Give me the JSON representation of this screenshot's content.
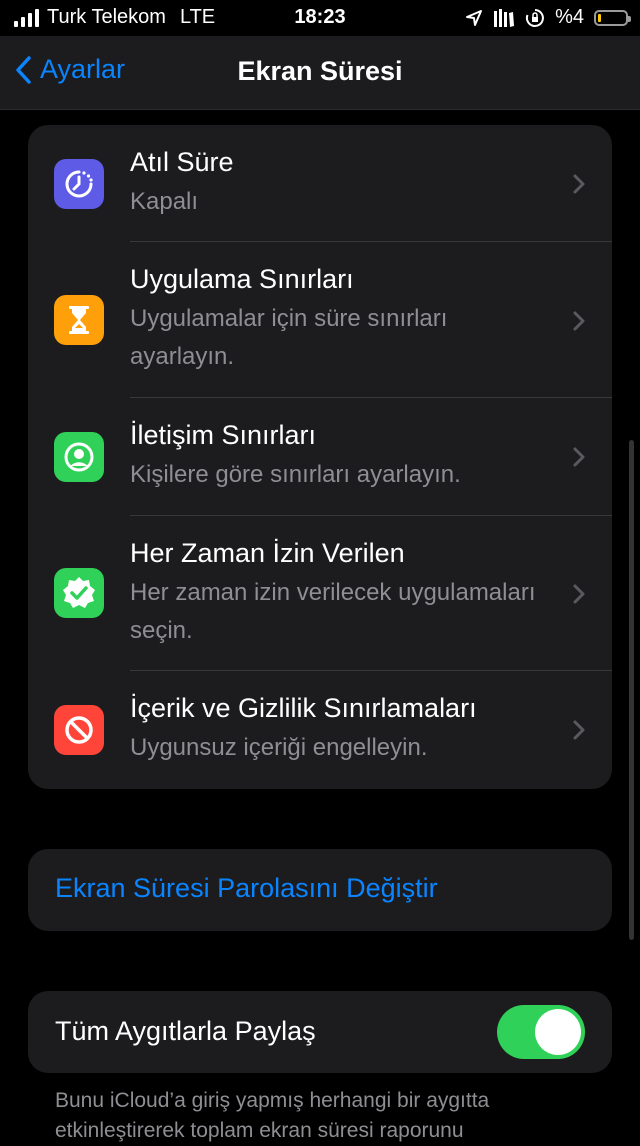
{
  "status_bar": {
    "carrier": "Turk Telekom",
    "network": "LTE",
    "time": "18:23",
    "battery_percent": "%4",
    "battery_level": 0.04,
    "icons": [
      "signal-icon",
      "location-icon",
      "library-icon",
      "rotation-lock-icon",
      "battery-icon"
    ]
  },
  "nav": {
    "back_label": "Ayarlar",
    "title": "Ekran Süresi"
  },
  "settings": {
    "items": [
      {
        "title": "Atıl Süre",
        "subtitle": "Kapalı",
        "icon": "downtime-icon",
        "color": "#5e5ce6"
      },
      {
        "title": "Uygulama Sınırları",
        "subtitle": "Uygulamalar için süre sınırları ayarlayın.",
        "icon": "hourglass-icon",
        "color": "#ff9f0a"
      },
      {
        "title": "İletişim Sınırları",
        "subtitle": "Kişilere göre sınırları ayarlayın.",
        "icon": "person-circle-icon",
        "color": "#30d158"
      },
      {
        "title": "Her Zaman İzin Verilen",
        "subtitle": "Her zaman izin verilecek uygulamaları seçin.",
        "icon": "checkmark-badge-icon",
        "color": "#30d158"
      },
      {
        "title": "İçerik ve Gizlilik Sınırlamaları",
        "subtitle": "Uygunsuz içeriği engelleyin.",
        "icon": "restriction-icon",
        "color": "#ff453a"
      }
    ]
  },
  "passcode": {
    "label": "Ekran Süresi Parolasını Değiştir"
  },
  "share": {
    "label": "Tüm Aygıtlarla Paylaş",
    "enabled": true,
    "footer": "Bunu iCloud’a giriş yapmış herhangi bir aygıtta etkinleştirerek toplam ekran süresi raporunu"
  },
  "colors": {
    "accent": "#0a84ff",
    "toggle_on": "#30d158",
    "background": "#000000",
    "cell": "#1c1c1e"
  }
}
